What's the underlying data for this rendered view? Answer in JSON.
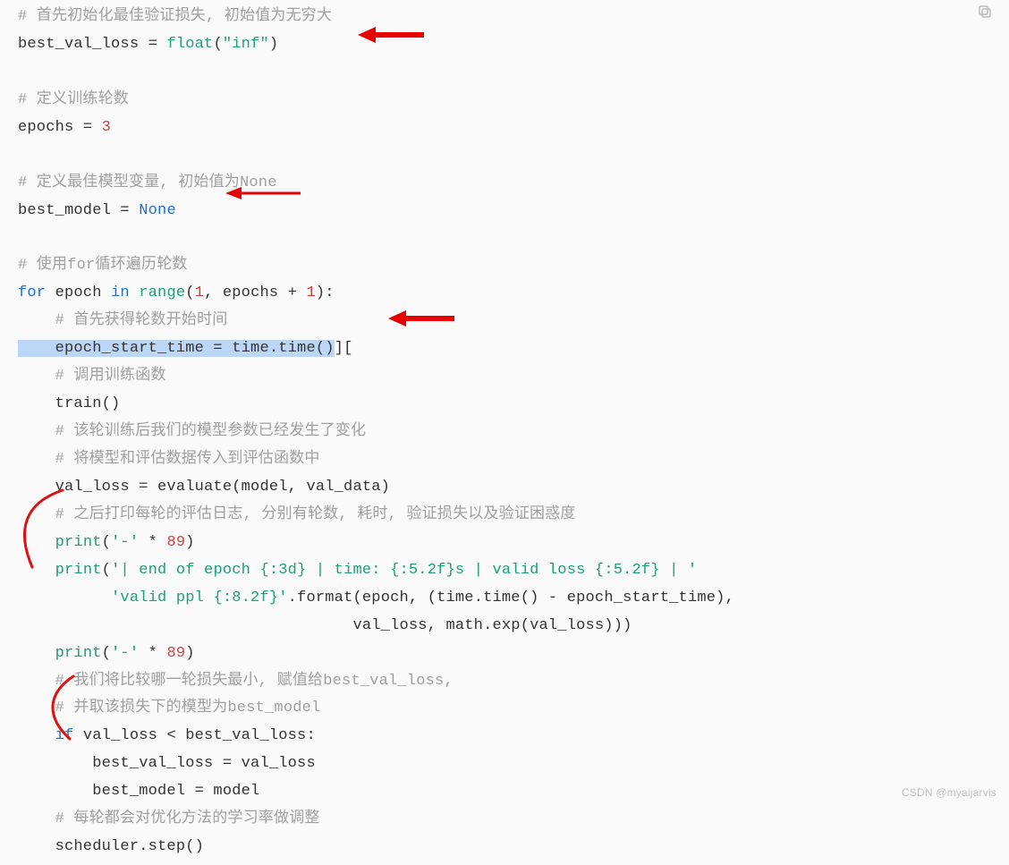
{
  "watermark": "CSDN @myaijarvis",
  "code": {
    "c1": "# 首先初始化最佳验证损失, 初始值为无穷大",
    "l2a": "best_val_loss = ",
    "l2b": "float",
    "l2c": "(",
    "l2d": "\"inf\"",
    "l2e": ")",
    "c3": "# 定义训练轮数",
    "l4a": "epochs = ",
    "l4b": "3",
    "c5": "# 定义最佳模型变量, 初始值为None",
    "l6a": "best_model = ",
    "l6b": "None",
    "c7": "# 使用for循环遍历轮数",
    "l8a": "for",
    "l8b": " epoch ",
    "l8c": "in",
    "l8d": " ",
    "l8e": "range",
    "l8f": "(",
    "l8g": "1",
    "l8h": ", epochs + ",
    "l8i": "1",
    "l8j": "):",
    "c9": "    # 首先获得轮数开始时间",
    "l10": "    epoch_start_time = time.time()",
    "l10cur": "][",
    "c11": "    # 调用训练函数",
    "l12": "    train()",
    "c13": "    # 该轮训练后我们的模型参数已经发生了变化",
    "c14": "    # 将模型和评估数据传入到评估函数中",
    "l15": "    val_loss = evaluate(model, val_data)",
    "c16": "    # 之后打印每轮的评估日志, 分别有轮数, 耗时, 验证损失以及验证困惑度",
    "l17a": "    ",
    "l17b": "print",
    "l17c": "(",
    "l17d": "'-'",
    "l17e": " * ",
    "l17f": "89",
    "l17g": ")",
    "l18a": "    ",
    "l18b": "print",
    "l18c": "(",
    "l18d": "'| end of epoch {:3d} | time: {:5.2f}s | valid loss {:5.2f} | '",
    "l19a": "          ",
    "l19b": "'valid ppl {:8.2f}'",
    "l19c": ".format(epoch, (time.time() - epoch_start_time),",
    "l20a": "                                    val_loss, math.exp(val_loss)))",
    "l21a": "    ",
    "l21b": "print",
    "l21c": "(",
    "l21d": "'-'",
    "l21e": " * ",
    "l21f": "89",
    "l21g": ")",
    "c22": "    # 我们将比较哪一轮损失最小, 赋值给best_val_loss,",
    "c23": "    # 并取该损失下的模型为best_model",
    "l24a": "    ",
    "l24b": "if",
    "l24c": " val_loss < best_val_loss:",
    "l25": "        best_val_loss = val_loss",
    "l26": "        best_model = model",
    "c27": "    # 每轮都会对优化方法的学习率做调整",
    "l28": "    scheduler.step()"
  }
}
